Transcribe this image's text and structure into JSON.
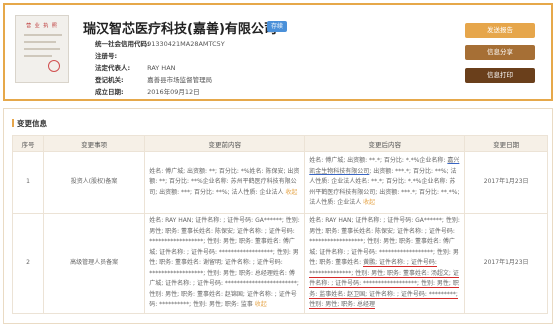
{
  "company": {
    "name": "瑞汉智芯医疗科技(嘉善)有限公司",
    "status": "存续",
    "fields": [
      {
        "label": "统一社会信用代码:",
        "value": "91330421MA28AMTC5Y"
      },
      {
        "label": "注册号:",
        "value": ""
      },
      {
        "label": "法定代表人:",
        "value": "RAY HAN"
      },
      {
        "label": "登记机关:",
        "value": "嘉善县市场监督管理局"
      },
      {
        "label": "成立日期:",
        "value": "2016年09月12日"
      }
    ]
  },
  "buttons": {
    "report": "发送报告",
    "share": "信息分享",
    "print": "信息打印"
  },
  "changes": {
    "title": "变更信息",
    "headers": [
      "序号",
      "变更事项",
      "变更前内容",
      "变更后内容",
      "变更日期"
    ],
    "more_label": "收起",
    "rows": [
      {
        "num": "1",
        "item": "投资人(股权)备案",
        "before": "姓名: 傅广城; 出资额: **; 百分比: *%姓名: 陈保安; 出资额: **; 百分比: **%企业名称: 苏州平鹤医疗科技有限公司; 出资额: ***; 百分比: **%; 法人性质: 企业法人",
        "after_a": "姓名: 傅广城; 出资额: **.*; 百分比: *.*%企业名称: ",
        "after_u": "嘉兴凯金生物科技有限公司",
        "after_b": "; 出资额: ***.*; 百分比: **%; 法人性质: 企业法人姓名: **.*; 百分比: *.*%企业名称: 苏州平鹤医疗科技有限公司; 出资额: ***.*; 百分比: **.*%; 法人性质: 企业法人",
        "date": "2017年1月23日"
      },
      {
        "num": "2",
        "item": "高级管理人员备案",
        "before": "姓名: RAY HAN; 证件名称: ; 证件号码: GA******; 性别: 男性; 职务: 董事长姓名: 陈保安; 证件名称: ; 证件号码: ******************; 性别: 男性; 职务: 董事姓名: 傅广城; 证件名称: ; 证件号码: ******************; 性别: 男性; 职务: 董事姓名: 谢留明; 证件名称: ; 证件号码: ******************; 性别: 男性; 职务: 总经理姓名: 傅广城; 证件名称: ; 证件号码: ************************; 性别: 男性; 职务: 董事姓名: 赵锦国; 证件名称: ; 证件号码: **********; 性别: 男性; 职务: 监事",
        "after_a": "姓名: RAY HAN; 证件名称: ; 证件号码: GA******; 性别: 男性; 职务: 董事长姓名: 陈保安; 证件名称: ; 证件号码: ******************; 性别: 男性; 职务: 董事姓名: 傅广城; 证件名称: ; 证件号码: ******************; 性别: 男性; 职务: 董事姓名: ",
        "after_r": "黄鹏; 证件名称: ; 证件号码: **************; 性别: 男性; 职务: 董事姓名: 汤超文; 证件名称: ; 证件号码: ******************; 性别: 男性; 职务: 监事姓名: 赵卫国; 证件名称: ; 证件号码: *********; 性别: 男性; 职务: 总经理",
        "after_b": "",
        "date": "2017年1月23日"
      }
    ]
  }
}
